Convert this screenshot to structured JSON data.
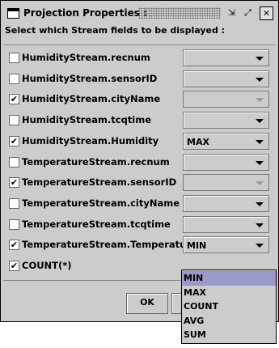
{
  "window": {
    "title": "Projection Properties :"
  },
  "heading": "Select which Stream fields to be displayed :",
  "fields": [
    {
      "label": "HumidityStream.recnum",
      "checked": false,
      "combo_value": "",
      "combo_enabled": true
    },
    {
      "label": "HumidityStream.sensorID",
      "checked": false,
      "combo_value": "",
      "combo_enabled": true
    },
    {
      "label": "HumidityStream.cityName",
      "checked": true,
      "combo_value": "",
      "combo_enabled": false
    },
    {
      "label": "HumidityStream.tcqtime",
      "checked": false,
      "combo_value": "",
      "combo_enabled": true
    },
    {
      "label": "HumidityStream.Humidity",
      "checked": true,
      "combo_value": "MAX",
      "combo_enabled": true
    },
    {
      "label": "TemperatureStream.recnum",
      "checked": false,
      "combo_value": "",
      "combo_enabled": true
    },
    {
      "label": "TemperatureStream.sensorID",
      "checked": true,
      "combo_value": "",
      "combo_enabled": false
    },
    {
      "label": "TemperatureStream.cityName",
      "checked": false,
      "combo_value": "",
      "combo_enabled": true
    },
    {
      "label": "TemperatureStream.tcqtime",
      "checked": false,
      "combo_value": "",
      "combo_enabled": true
    },
    {
      "label": "TemperatureStream.Temperature",
      "checked": true,
      "combo_value": "MIN",
      "combo_enabled": true
    },
    {
      "label": "COUNT(*)",
      "checked": true,
      "combo_value": "",
      "combo_enabled": true
    }
  ],
  "buttons": {
    "ok": "OK"
  },
  "dropdown": {
    "options": [
      "MIN",
      "MAX",
      "COUNT",
      "AVG",
      "SUM"
    ],
    "selected": "MIN"
  },
  "glyphs": {
    "check": "✔",
    "close": "✕",
    "iconify": "⇲",
    "maximize": "⤢"
  }
}
